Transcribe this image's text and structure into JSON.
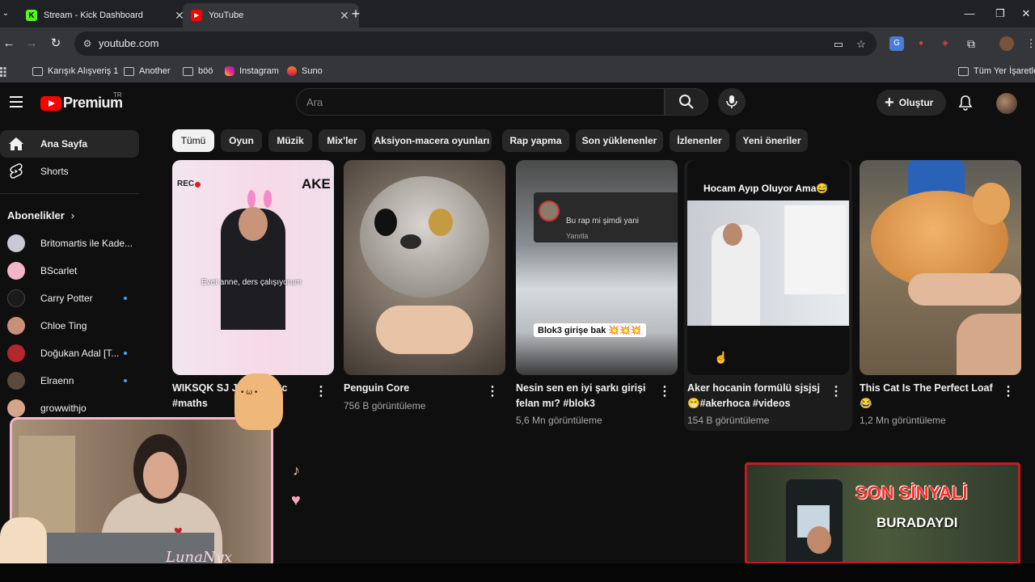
{
  "browser": {
    "tabs": [
      {
        "title": "Stream - Kick Dashboard",
        "active": false,
        "favicon": "kick-icon",
        "favicon_color": "#53fc18"
      },
      {
        "title": "YouTube",
        "active": true,
        "favicon": "youtube-icon",
        "favicon_color": "#ff0000"
      }
    ],
    "url": "youtube.com",
    "bookmarks": [
      {
        "label": "Karışık Alışveriş 1",
        "icon": "folder-icon"
      },
      {
        "label": "Another",
        "icon": "folder-icon"
      },
      {
        "label": "böö",
        "icon": "folder-icon"
      },
      {
        "label": "Instagram",
        "icon": "instagram-icon"
      },
      {
        "label": "Suno",
        "icon": "suno-icon"
      }
    ],
    "bookmarks_right": "Tüm Yer İşaretle"
  },
  "youtube": {
    "logo": "Premium",
    "region": "TR",
    "search_placeholder": "Ara",
    "create_label": "Oluştur",
    "sidebar": {
      "items": [
        {
          "label": "Ana Sayfa",
          "icon": "home-icon",
          "active": true
        },
        {
          "label": "Shorts",
          "icon": "shorts-icon",
          "active": false
        }
      ],
      "subscriptions_title": "Abonelikler",
      "subscriptions": [
        {
          "name": "Britomartis ile Kade...",
          "new": false,
          "color": "#c9c9d6"
        },
        {
          "name": "BScarlet",
          "new": false,
          "color": "#f4b5c8"
        },
        {
          "name": "Carry Potter",
          "new": true,
          "color": "#1b1b1b"
        },
        {
          "name": "Chloe Ting",
          "new": false,
          "color": "#c98f78"
        },
        {
          "name": "Doğukan Adal [T...",
          "new": true,
          "color": "#b2262c"
        },
        {
          "name": "Elraenn",
          "new": true,
          "color": "#5a4a3e"
        },
        {
          "name": "growwithjo",
          "new": false,
          "color": "#d4a58a"
        }
      ]
    },
    "chips": [
      "Tümü",
      "Oyun",
      "Müzik",
      "Mix'ler",
      "Aksiyon-macera oyunları",
      "Rap yapma",
      "Son yüklenenler",
      "İzlenenler",
      "Yeni öneriler"
    ],
    "videos": [
      {
        "title": "WIKSQK SJ JJD JJD Cc #maths",
        "views": "",
        "overlay": "REC",
        "caption": "Evet anne, ders çalışıyorum",
        "brand": "AKE"
      },
      {
        "title": "Penguin Core",
        "views": "756 B görüntüleme"
      },
      {
        "title": "Nesin sen en iyi şarkı  girişi felan mı? #blok3",
        "views": "5,6 Mn görüntüleme",
        "overlay": "Bu rap mi şimdi yani",
        "reply": "Yanıtla",
        "caption": "Blok3 girişe bak 💥💥💥"
      },
      {
        "title": "Aker hocanin formülü sjsjsj 😁#akerhoca #videos",
        "views": "154 B görüntüleme",
        "overlay": "Hocam Ayıp Oluyor Ama😅"
      },
      {
        "title": "This Cat Is The Perfect Loaf 😂",
        "views": "1,2 Mn görüntüleme"
      }
    ],
    "mini_player": {
      "line1": "SON SİNYALİ",
      "line2": "BURADAYDI"
    },
    "webcam_watermark": "LunaNyx"
  }
}
